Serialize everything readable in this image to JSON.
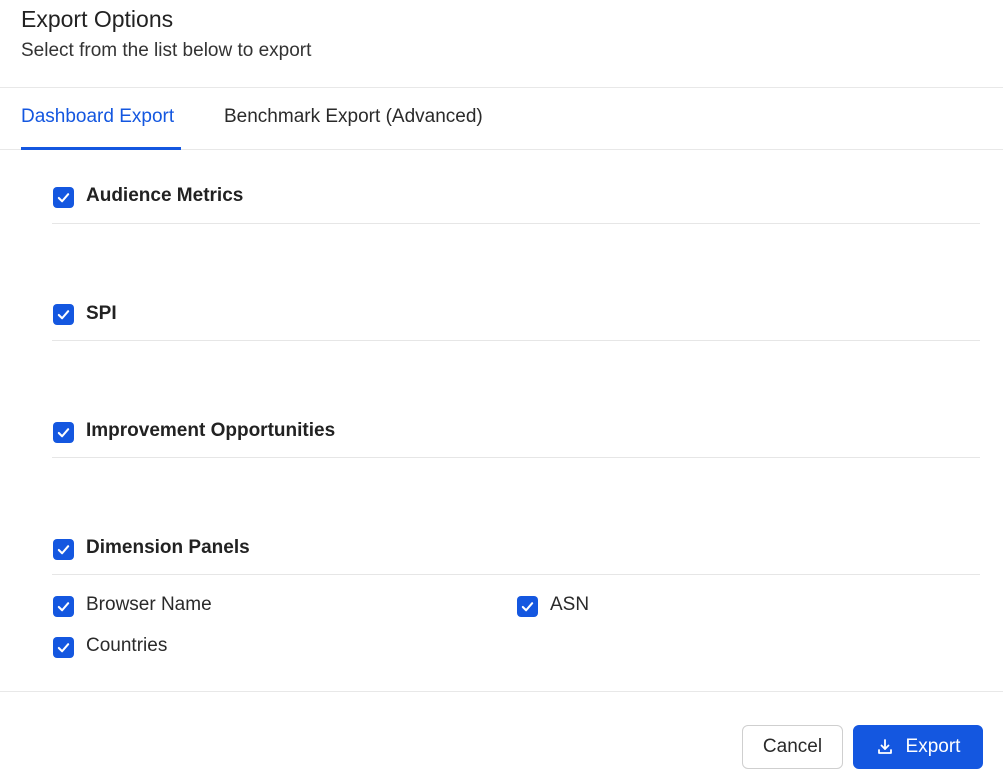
{
  "header": {
    "title": "Export Options",
    "subtitle": "Select from the list below to export"
  },
  "tabs": [
    {
      "label": "Dashboard Export",
      "active": true
    },
    {
      "label": "Benchmark Export (Advanced)",
      "active": false
    }
  ],
  "sections": [
    {
      "label": "Audience Metrics",
      "checked": true
    },
    {
      "label": "SPI",
      "checked": true
    },
    {
      "label": "Improvement Opportunities",
      "checked": true
    },
    {
      "label": "Dimension Panels",
      "checked": true
    }
  ],
  "dimension_items": [
    {
      "label": "Browser Name",
      "checked": true
    },
    {
      "label": "ASN",
      "checked": true
    },
    {
      "label": "Countries",
      "checked": true
    }
  ],
  "footer": {
    "cancel_label": "Cancel",
    "export_label": "Export"
  },
  "colors": {
    "accent": "#1457e0"
  },
  "icons": {
    "checkbox": "check-icon",
    "export": "download-icon"
  }
}
